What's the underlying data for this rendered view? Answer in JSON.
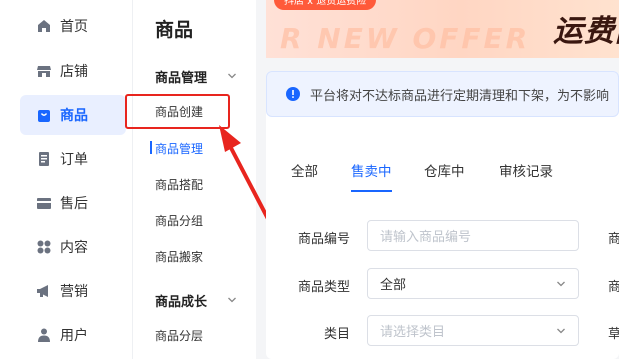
{
  "nav": {
    "items": [
      {
        "label": "首页",
        "icon": "home-icon"
      },
      {
        "label": "店铺",
        "icon": "store-icon"
      },
      {
        "label": "商品",
        "icon": "shopping-bag-icon",
        "active": true
      },
      {
        "label": "订单",
        "icon": "order-icon"
      },
      {
        "label": "售后",
        "icon": "after-sale-icon"
      },
      {
        "label": "内容",
        "icon": "content-icon"
      },
      {
        "label": "营销",
        "icon": "megaphone-icon"
      },
      {
        "label": "用户",
        "icon": "user-icon"
      }
    ]
  },
  "subnav": {
    "title": "商品",
    "group1": "商品管理",
    "items1": [
      "商品创建",
      "商品管理",
      "商品搭配",
      "商品分组",
      "商品搬家"
    ],
    "group2": "商品成长",
    "items2": [
      "商品分层"
    ],
    "active_item": "商品管理"
  },
  "banner": {
    "tag": "抖店 x 退货运费险",
    "big_text": "运费险",
    "deco_text": "R NEW OFFER"
  },
  "notice": {
    "text": "平台将对不达标商品进行定期清理和下架，为不影响"
  },
  "tabs": [
    "全部",
    "售卖中",
    "仓库中",
    "审核记录"
  ],
  "active_tab": "售卖中",
  "filters": {
    "product_id": {
      "label": "商品编号",
      "placeholder": "请输入商品编号"
    },
    "product_type": {
      "label": "商品类型",
      "value": "全部"
    },
    "category": {
      "label": "类目",
      "placeholder": "请选择类目"
    },
    "right_labels": [
      "商",
      "商",
      "草"
    ]
  },
  "colors": {
    "accent": "#1966ff",
    "highlight_red": "#e8251e",
    "notice_bg": "#eef3ff"
  }
}
